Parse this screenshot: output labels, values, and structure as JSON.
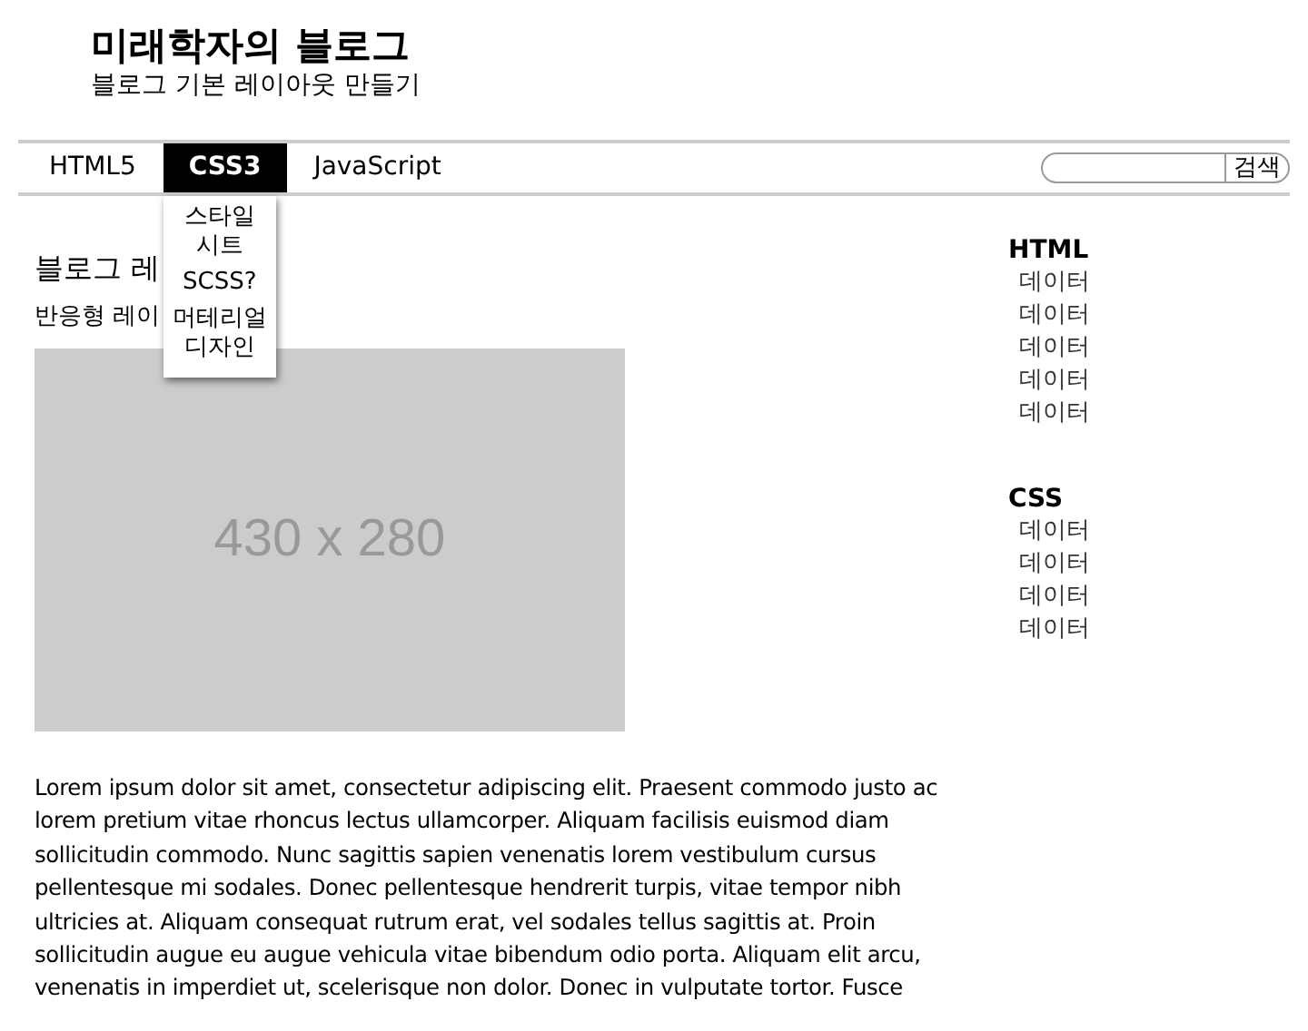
{
  "header": {
    "title": "미래학자의 블로그",
    "subtitle": "블로그 기본 레이아웃 만들기"
  },
  "nav": {
    "items": [
      {
        "label": "HTML5",
        "selected": false
      },
      {
        "label": "CSS3",
        "selected": true,
        "submenu": [
          "스타일 시트",
          "SCSS?",
          "머테리얼 디자인"
        ]
      },
      {
        "label": "JavaScript",
        "selected": false
      }
    ],
    "search_button": "검색"
  },
  "article": {
    "heading": "블로그 레",
    "subheading": "반응형 레이",
    "image_placeholder": "430 x 280",
    "body": "Lorem ipsum dolor sit amet, consectetur adipiscing elit. Praesent commodo justo ac lorem pretium vitae rhoncus lectus ullamcorper. Aliquam facilisis euismod diam sollicitudin commodo. Nunc sagittis sapien venenatis lorem vestibulum cursus pellentesque mi sodales. Donec pellentesque hendrerit turpis, vitae tempor nibh ultricies at. Aliquam consequat rutrum erat, vel sodales tellus sagittis at. Proin sollicitudin augue eu augue vehicula vitae bibendum odio porta. Aliquam elit arcu, venenatis in imperdiet ut, scelerisque non dolor. Donec in vulputate tortor. Fusce"
  },
  "sidebar": [
    {
      "title": "HTML",
      "items": [
        "데이터",
        "데이터",
        "데이터",
        "데이터",
        "데이터"
      ]
    },
    {
      "title": "CSS",
      "items": [
        "데이터",
        "데이터",
        "데이터",
        "데이터"
      ]
    }
  ]
}
